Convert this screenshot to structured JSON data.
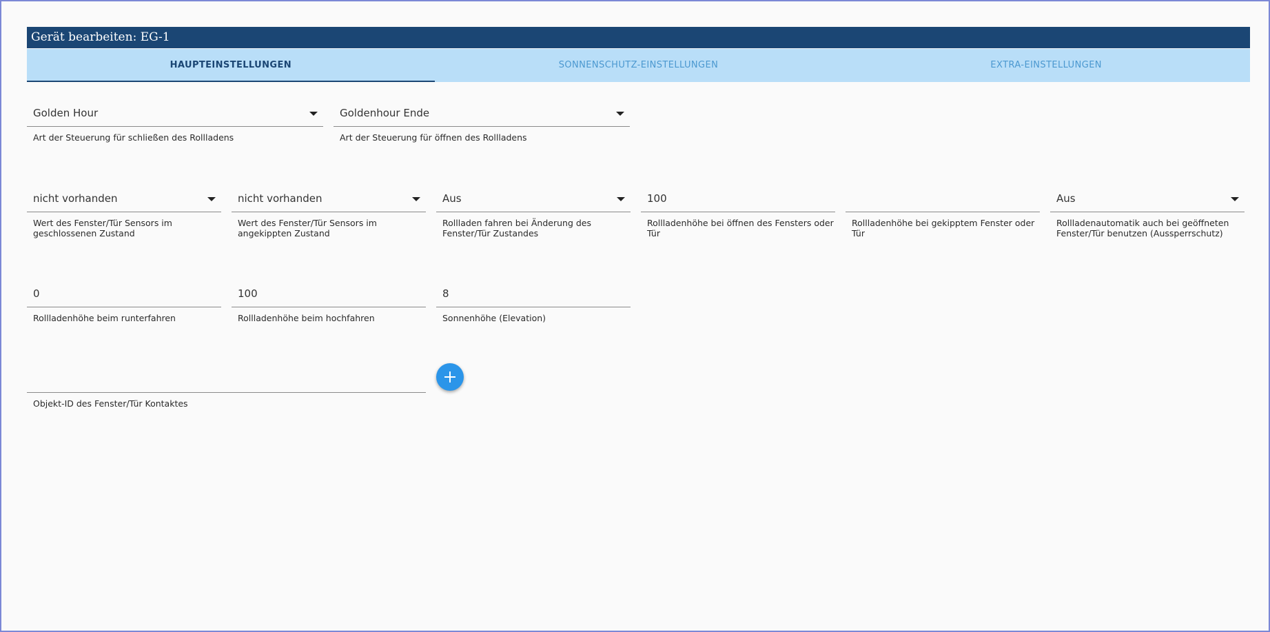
{
  "dialog": {
    "title": "Gerät bearbeiten: EG-1"
  },
  "tabs": [
    {
      "label": "HAUPTEINSTELLUNGEN",
      "active": true
    },
    {
      "label": "SONNENSCHUTZ-EINSTELLUNGEN",
      "active": false
    },
    {
      "label": "EXTRA-EINSTELLUNGEN",
      "active": false
    }
  ],
  "row1": {
    "close_type": {
      "value": "Golden Hour",
      "helper": "Art der Steuerung für schließen des Rollladens"
    },
    "open_type": {
      "value": "Goldenhour Ende",
      "helper": "Art der Steuerung für öffnen des Rollladens"
    }
  },
  "row2": {
    "sensor_closed": {
      "value": "nicht vorhanden",
      "helper": "Wert des Fenster/Tür Sensors im geschlossenen Zustand"
    },
    "sensor_tilted": {
      "value": "nicht vorhanden",
      "helper": "Wert des Fenster/Tür Sensors im angekippten Zustand"
    },
    "drive_on_change": {
      "value": "Aus",
      "helper": "Rollladen fahren bei Änderung des Fenster/Tür Zustandes"
    },
    "height_open_window": {
      "value": "100",
      "helper": "Rollladenhöhe bei öffnen des Fensters oder Tür"
    },
    "height_tilted_window": {
      "value": "",
      "helper": "Rollladenhöhe bei gekipptem Fenster oder Tür"
    },
    "lockout_protection": {
      "value": "Aus",
      "helper": "Rollladenautomatik auch bei geöffneten Fenster/Tür benutzen (Aussperrschutz)"
    }
  },
  "row3": {
    "height_down": {
      "value": "0",
      "helper": "Rollladenhöhe beim runterfahren"
    },
    "height_up": {
      "value": "100",
      "helper": "Rollladenhöhe beim hochfahren"
    },
    "elevation": {
      "value": "8",
      "helper": "Sonnenhöhe (Elevation)"
    }
  },
  "row4": {
    "contact_object_id": {
      "value": "",
      "helper": "Objekt-ID des Fenster/Tür Kontaktes"
    }
  },
  "icons": {
    "dropdown": "triangle-down-icon",
    "add": "plus-icon"
  },
  "colors": {
    "title_bar": "#1b4674",
    "tab_bar": "#b9def8",
    "tab_inactive_text": "#4b98d0",
    "fab": "#2b95e9",
    "frame_border": "#7b88d6"
  }
}
